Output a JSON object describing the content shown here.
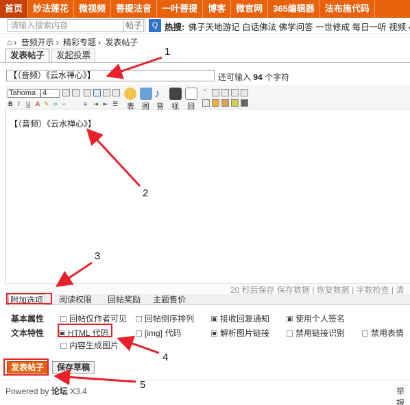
{
  "nav": [
    "首页",
    "妙法莲花",
    "微视频",
    "菩提法音",
    "一叶菩提",
    "博客",
    "微官网",
    "365编辑器",
    "法布施代码"
  ],
  "search": {
    "placeholder": "请输入搜索内容",
    "type": "帖子",
    "button": "Q"
  },
  "hot": {
    "label": "热搜:",
    "items": [
      "佛子天地游记",
      "白话佛法",
      "佛学问答",
      "一世修成",
      "每日一听",
      "视频",
      "小"
    ]
  },
  "breadcrumb": [
    "音频开示",
    "精彩专题",
    "发表帖子"
  ],
  "tabs": [
    "发表帖子",
    "发起投票"
  ],
  "title_input": "【（音频）《云水禅心》】",
  "remain": {
    "prefix": "还可输入",
    "count": "94",
    "suffix": "个字符"
  },
  "toolbar": {
    "font": "Tahoma",
    "size": "4",
    "big_labels": [
      "表",
      "图",
      "音",
      "视",
      "回"
    ]
  },
  "editor_content": "【（音频）《云水禅心》】",
  "savebar": "20 秒后保存 保存数据 | 恢复数据 | 字数检查 | 清",
  "options_tabs": [
    "附加选项",
    "阅读权限",
    "回帖奖励",
    "主题售价"
  ],
  "options": {
    "basic_label": "基本属性",
    "basic": [
      {
        "label": "回帖仅作者可见",
        "checked": false
      },
      {
        "label": "回帖倒序排列",
        "checked": false
      },
      {
        "label": "接收回复通知",
        "checked": true
      },
      {
        "label": "使用个人签名",
        "checked": true
      }
    ],
    "text_label": "文本特性",
    "text": [
      {
        "label": "HTML 代码",
        "checked": true
      },
      {
        "label": "[img] 代码",
        "checked": false
      },
      {
        "label": "解析图片链接",
        "checked": true
      },
      {
        "label": "禁用链接识别",
        "checked": false
      },
      {
        "label": "禁用表情",
        "checked": false
      },
      {
        "label": "内容生成图片",
        "checked": false
      }
    ]
  },
  "buttons": {
    "submit": "发表帖子",
    "draft": "保存草稿"
  },
  "footer": {
    "powered": "Powered by",
    "brand": "论坛",
    "version": "X3.4",
    "report": "举报"
  },
  "annotations": [
    "1",
    "2",
    "3",
    "4",
    "5"
  ],
  "colors": {
    "nav": "#e8610c",
    "accent": "#e8202a"
  }
}
